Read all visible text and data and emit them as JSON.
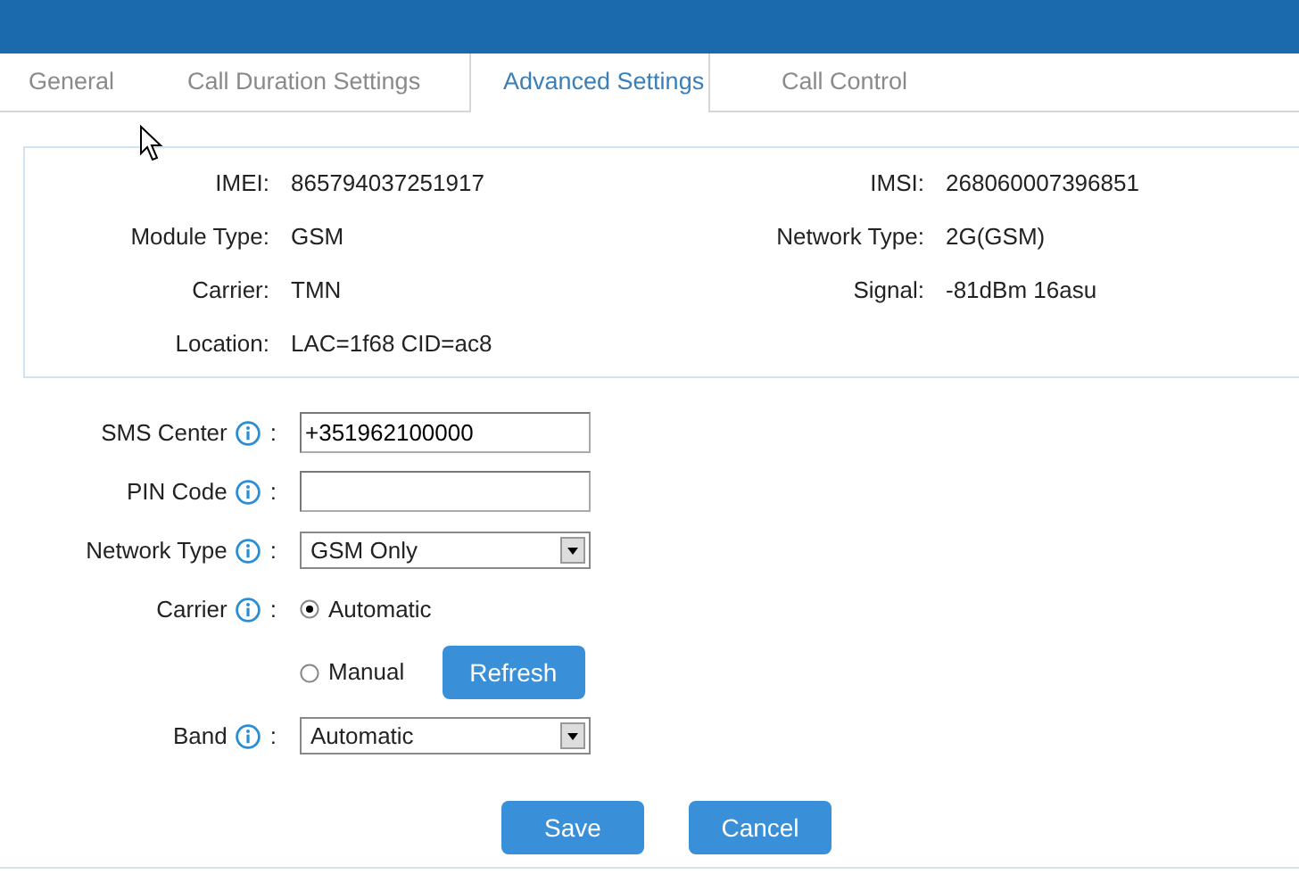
{
  "tabs": [
    {
      "label": "General",
      "selected": false
    },
    {
      "label": "Call Duration Settings",
      "selected": false
    },
    {
      "label": "Advanced Settings",
      "selected": true
    },
    {
      "label": "Call Control",
      "selected": false
    }
  ],
  "status": {
    "rows": [
      {
        "left": {
          "label": "IMEI:",
          "value": "865794037251917"
        },
        "right": {
          "label": "IMSI:",
          "value": "268060007396851"
        }
      },
      {
        "left": {
          "label": "Module Type:",
          "value": "GSM"
        },
        "right": {
          "label": "Network Type:",
          "value": "2G(GSM)"
        }
      },
      {
        "left": {
          "label": "Carrier:",
          "value": "TMN"
        },
        "right": {
          "label": "Signal:",
          "value": "-81dBm 16asu"
        }
      },
      {
        "left": {
          "label": "Location:",
          "value": "LAC=1f68 CID=ac8"
        }
      }
    ]
  },
  "form": [
    {
      "kind": "text",
      "label": "SMS Center",
      "separator": ":",
      "value": "+351962100000"
    },
    {
      "kind": "text",
      "label": "PIN Code",
      "separator": ":"
    },
    {
      "kind": "select",
      "label": "Network Type",
      "separator": ":",
      "value": "GSM Only"
    },
    {
      "kind": "radio",
      "label": "Carrier",
      "separator": ":",
      "options": [
        {
          "label": "Automatic",
          "selected": true
        },
        {
          "label": "Manual",
          "selected": false,
          "button": "Refresh"
        }
      ]
    },
    {
      "kind": "select",
      "label": "Band",
      "separator": ":",
      "value": "Automatic"
    }
  ],
  "buttons": [
    "Save",
    "Cancel"
  ]
}
